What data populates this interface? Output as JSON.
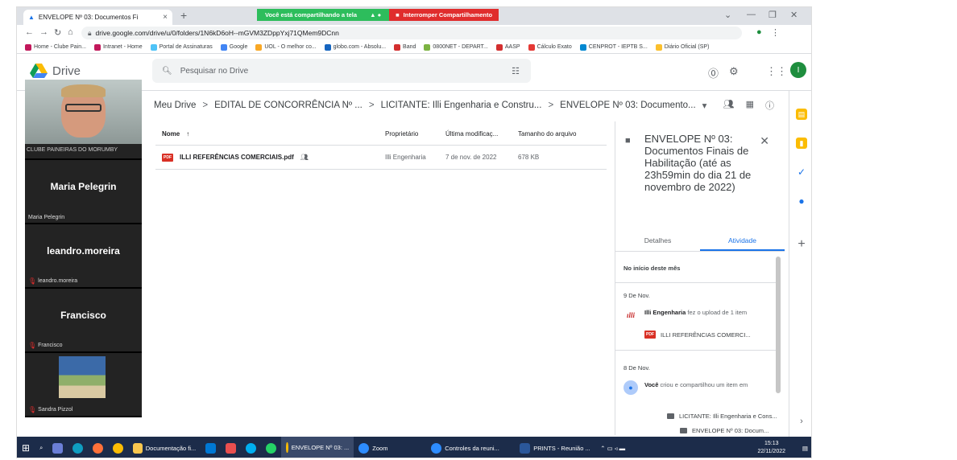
{
  "browser": {
    "tab_title": "ENVELOPE Nº 03: Documentos Fi",
    "url": "drive.google.com/drive/u/0/folders/1N6kD6oH--mGVM3ZDppYxj71QMem9DCnn",
    "share_text": "Você está compartilhando a tela",
    "stop_share": "Interromper Compartilhamento",
    "bookmarks": [
      "Home - Clube Pain...",
      "Intranet - Home",
      "Portal de Assinaturas",
      "Google",
      "UOL - O melhor co...",
      "globo.com - Absolu...",
      "Band",
      "0800NET - DEPART...",
      "AASP",
      "Cálculo Exato",
      "CENPROT - IEPTB S...",
      "Diário Oficial (SP)"
    ]
  },
  "drive": {
    "logo": "Drive",
    "search_placeholder": "Pesquisar no Drive",
    "user_initial": "I",
    "breadcrumb": [
      "Meu Drive",
      "EDITAL DE CONCORRÊNCIA Nº ...",
      "LICITANTE: Illi Engenharia e Constru...",
      "ENVELOPE Nº 03: Documento..."
    ],
    "columns": [
      "Nome",
      "Proprietário",
      "Última modificaç...",
      "Tamanho do arquivo"
    ],
    "files": [
      {
        "name": "ILLI REFERÊNCIAS COMERCIAIS.pdf",
        "owner": "Illi Engenharia",
        "modified": "7 de nov. de 2022",
        "size": "678 KB",
        "type": "PDF"
      }
    ]
  },
  "details": {
    "title": "ENVELOPE Nº 03: Documentos Finais de Habilitação (até as 23h59min do dia 21 de novembro de 2022)",
    "tab_details": "Detalhes",
    "tab_activity": "Atividade",
    "section_month": "No início deste mês",
    "date1": "9 De Nov.",
    "event1_actor": "Illi Engenharia",
    "event1_text": "fez o upload de 1 item",
    "event1_file": "ILLI REFERÊNCIAS COMERCI...",
    "date2": "8 De Nov.",
    "event2_actor": "Você",
    "event2_text": "criou e compartilhou um item em",
    "event2_folder1": "LICITANTE: Illi Engenharia e Cons...",
    "event2_folder2": "ENVELOPE Nº 03: Docum..."
  },
  "zoom": {
    "cam_label": "CLUBE PAINEIRAS DO MORUMBY",
    "participants": [
      {
        "display": "Maria Pelegrin",
        "label": "Maria Pelegrin"
      },
      {
        "display": "leandro.moreira",
        "label": "leandro.moreira"
      },
      {
        "display": "Francisco",
        "label": "Francisco"
      },
      {
        "display": "",
        "label": "Sandra Pizzol"
      }
    ]
  },
  "taskbar": {
    "items": [
      "Documentação fi...",
      "ENVELOPE Nº 03: ...",
      "Zoom",
      "Controles da reuni...",
      "PRINTS - Reunião ..."
    ],
    "time": "15:13",
    "date": "22/11/2022"
  },
  "colors": {
    "accent": "#1a73e8",
    "share_green": "#2dbd5c",
    "stop_red": "#e02d2d",
    "pdf_red": "#d93025"
  }
}
